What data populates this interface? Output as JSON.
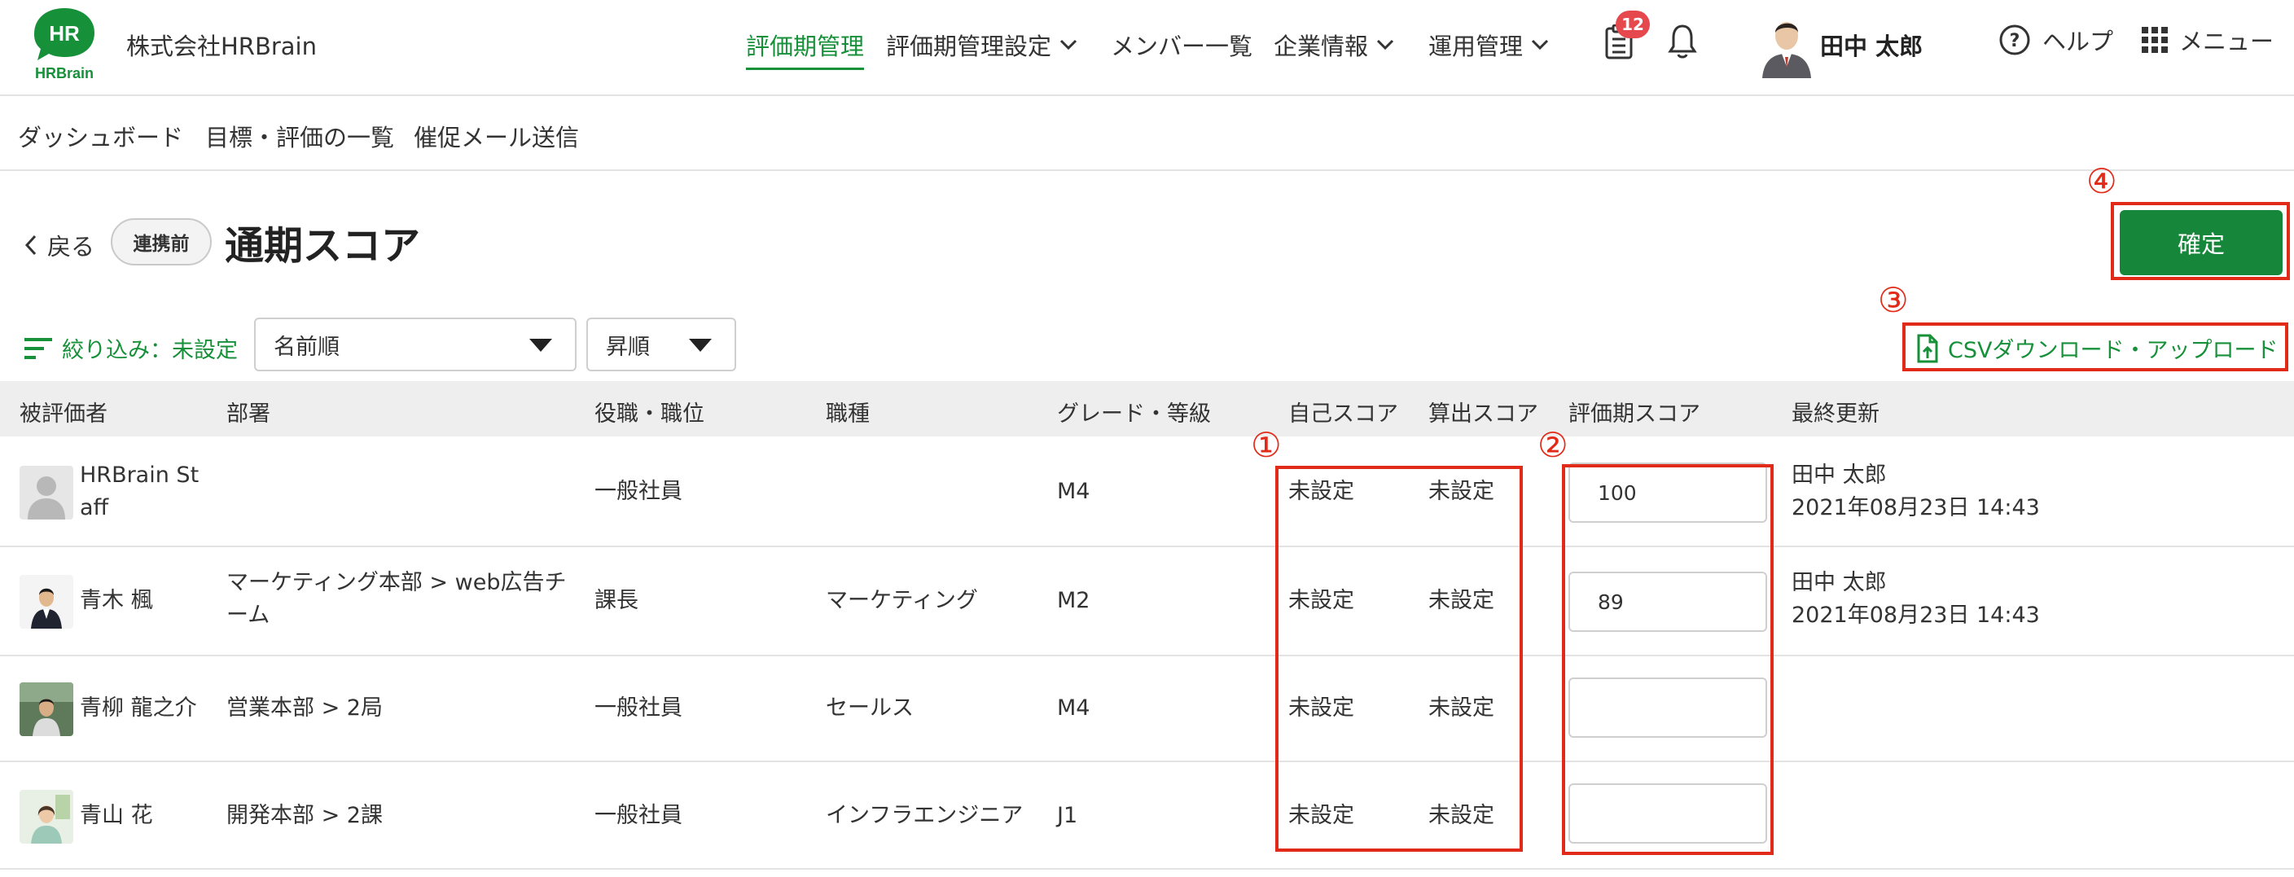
{
  "header": {
    "company": "株式会社HRBrain",
    "logo_text_top": "HR",
    "logo_text_bottom": "HRBrain",
    "nav": [
      {
        "label": "評価期管理",
        "active": true
      },
      {
        "label": "評価期管理設定",
        "dropdown": true
      },
      {
        "label": "メンバー一覧"
      },
      {
        "label": "企業情報",
        "dropdown": true
      },
      {
        "label": "運用管理",
        "dropdown": true
      }
    ],
    "notification_count": "12",
    "user_name": "田中 太郎",
    "help_label": "ヘルプ",
    "menu_label": "メニュー"
  },
  "subnav": [
    "ダッシュボード",
    "目標・評価の一覧",
    "催促メール送信"
  ],
  "title_row": {
    "back_label": "戻る",
    "status_pill": "連携前",
    "page_title": "通期スコア",
    "confirm_label": "確定"
  },
  "filter_row": {
    "filter_label": "絞り込み：未設定",
    "sort_by": "名前順",
    "sort_order": "昇順",
    "csv_label": "CSVダウンロード・アップロード"
  },
  "table": {
    "columns": [
      "被評価者",
      "部署",
      "役職・職位",
      "職種",
      "グレード・等級",
      "自己スコア",
      "算出スコア",
      "評価期スコア",
      "最終更新"
    ],
    "rows": [
      {
        "name_line1": "HRBrain St",
        "name_line2": "aff",
        "dept_line1": "",
        "dept_line2": "",
        "position": "一般社員",
        "job": "",
        "grade": "M4",
        "self_score": "未設定",
        "calc_score": "未設定",
        "period_score": "100",
        "updated_by": "田中 太郎",
        "updated_at": "2021年08月23日 14:43"
      },
      {
        "name_line1": "青木 楓",
        "name_line2": "",
        "dept_line1": "マーケティング本部 > web広告チ",
        "dept_line2": "ーム",
        "position": "課長",
        "job": "マーケティング",
        "grade": "M2",
        "self_score": "未設定",
        "calc_score": "未設定",
        "period_score": "89",
        "updated_by": "田中 太郎",
        "updated_at": "2021年08月23日 14:43"
      },
      {
        "name_line1": "青柳 龍之介",
        "name_line2": "",
        "dept_line1": "営業本部 > 2局",
        "dept_line2": "",
        "position": "一般社員",
        "job": "セールス",
        "grade": "M4",
        "self_score": "未設定",
        "calc_score": "未設定",
        "period_score": "",
        "updated_by": "",
        "updated_at": ""
      },
      {
        "name_line1": "青山 花",
        "name_line2": "",
        "dept_line1": "開発本部 > 2課",
        "dept_line2": "",
        "position": "一般社員",
        "job": "インフラエンジニア",
        "grade": "J1",
        "self_score": "未設定",
        "calc_score": "未設定",
        "period_score": "",
        "updated_by": "",
        "updated_at": ""
      }
    ]
  },
  "annotations": {
    "n1": "①",
    "n2": "②",
    "n3": "③",
    "n4": "④"
  },
  "colors": {
    "brand_green": "#17903a",
    "button_green": "#16873a",
    "annotation_red": "#e22a18",
    "badge_red": "#e5484d"
  }
}
